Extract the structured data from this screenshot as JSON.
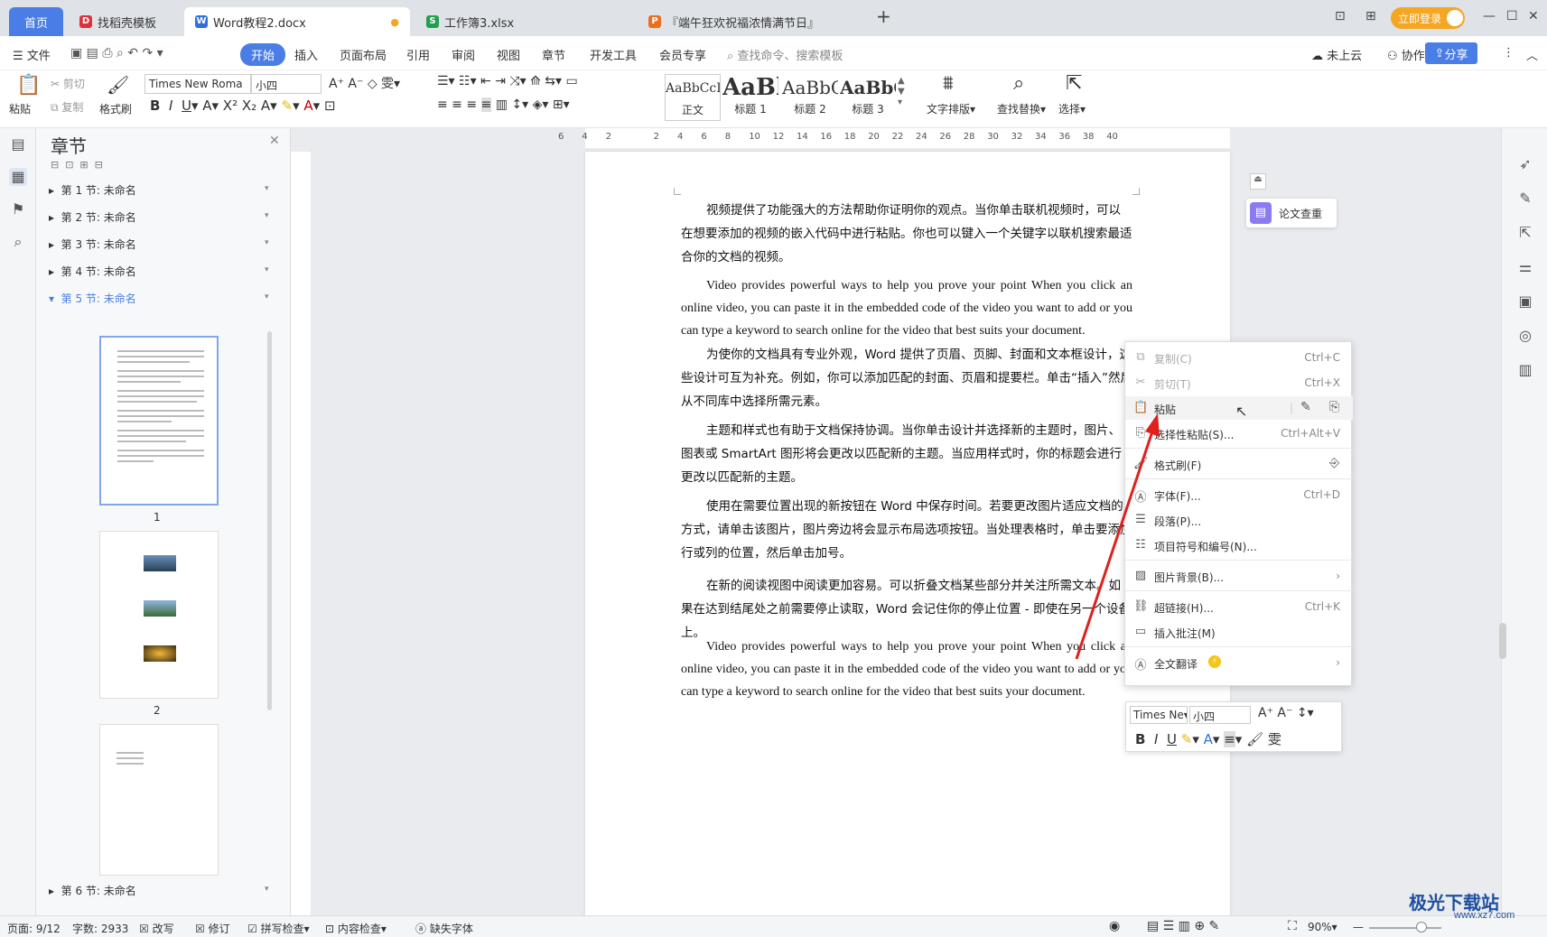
{
  "tabs": [
    {
      "label": "首页"
    },
    {
      "label": "找稻壳模板",
      "icon_color": "#e0303c"
    },
    {
      "label": "Word教程2.docx",
      "icon_color": "#2f6fe0"
    },
    {
      "label": "工作簿3.xlsx",
      "icon_color": "#22a050"
    },
    {
      "label": "『端午狂欢祝福浓情满节日』",
      "icon_color": "#ef6c1c"
    }
  ],
  "login_label": "立即登录",
  "menu": {
    "file": "文件",
    "items": [
      "开始",
      "插入",
      "页面布局",
      "引用",
      "审阅",
      "视图",
      "章节",
      "开发工具",
      "会员专享"
    ],
    "search_placeholder": "查找命令、搜索模板",
    "cloud": "未上云",
    "collab": "协作",
    "share": "分享"
  },
  "ribbon": {
    "paste": "粘贴",
    "cut": "剪切",
    "copy": "复制",
    "format_painter": "格式刷",
    "font": "Times New Roma",
    "size": "小四",
    "styles": [
      {
        "sample": "AaBbCcI",
        "label": "正文"
      },
      {
        "sample": "AaBl",
        "label": "标题 1"
      },
      {
        "sample": "AaBbC",
        "label": "标题 2"
      },
      {
        "sample": "AaBbC",
        "label": "标题 3"
      }
    ],
    "text_layout": "文字排版",
    "find_replace": "查找替换",
    "select": "选择"
  },
  "chapter_panel": {
    "title": "章节",
    "sections": [
      "第 1 节: 未命名",
      "第 2 节: 未命名",
      "第 3 节: 未命名",
      "第 4 节: 未命名",
      "第 5 节: 未命名",
      "第 6 节: 未命名"
    ],
    "active_index": 4,
    "page_numbers": [
      "1",
      "2"
    ]
  },
  "ruler_ticks": [
    "6",
    "4",
    "2",
    "",
    "2",
    "4",
    "6",
    "8",
    "10",
    "12",
    "14",
    "16",
    "18",
    "20",
    "22",
    "24",
    "26",
    "28",
    "30",
    "32",
    "34",
    "36",
    "38",
    "40"
  ],
  "document": {
    "paragraphs": [
      "视频提供了功能强大的方法帮助你证明你的观点。当你单击联机视频时，可以在想要添加的视频的嵌入代码中进行粘贴。你也可以键入一个关键字以联机搜索最适合你的文档的视频。",
      "Video provides powerful ways to help you prove your point When you click an online video, you can paste it in the embedded code of the video you want to add or you can type a keyword to search online for the video that best suits your document.",
      "为使你的文档具有专业外观，Word 提供了页眉、页脚、封面和文本框设计，这些设计可互为补充。例如，你可以添加匹配的封面、页眉和提要栏。单击“插入”然后从不同库中选择所需元素。",
      "主题和样式也有助于文档保持协调。当你单击设计并选择新的主题时，图片、图表或 SmartArt 图形将会更改以匹配新的主题。当应用样式时，你的标题会进行更改以匹配新的主题。",
      "使用在需要位置出现的新按钮在 Word 中保存时间。若要更改图片适应文档的方式，请单击该图片，图片旁边将会显示布局选项按钮。当处理表格时，单击要添加行或列的位置，然后单击加号。",
      "在新的阅读视图中阅读更加容易。可以折叠文档某些部分并关注所需文本。如果在达到结尾处之前需要停止读取，Word 会记住你的停止位置 - 即使在另一个设备上。",
      "Video provides powerful ways to help you prove your point When you click an online video, you can paste it in the embedded code of the video you want to add or you can type a keyword to search online for the video that best suits your document."
    ]
  },
  "paper_check": "论文查重",
  "context_menu": {
    "items": [
      {
        "label": "复制(C)",
        "shortcut": "Ctrl+C",
        "icon": "copy-icon",
        "disabled": true
      },
      {
        "label": "剪切(T)",
        "shortcut": "Ctrl+X",
        "icon": "scissors-icon",
        "disabled": true
      },
      {
        "label": "粘贴",
        "shortcut": "",
        "icon": "paste-icon",
        "disabled": false
      },
      {
        "label": "选择性粘贴(S)...",
        "shortcut": "Ctrl+Alt+V",
        "icon": "paste-special-icon",
        "disabled": false
      },
      {
        "label": "格式刷(F)",
        "shortcut": "",
        "icon": "format-painter-icon",
        "disabled": false
      },
      {
        "label": "字体(F)...",
        "shortcut": "Ctrl+D",
        "icon": "font-icon",
        "disabled": false
      },
      {
        "label": "段落(P)...",
        "shortcut": "",
        "icon": "paragraph-icon",
        "disabled": false
      },
      {
        "label": "项目符号和编号(N)...",
        "shortcut": "",
        "icon": "list-icon",
        "disabled": false
      },
      {
        "label": "图片背景(B)...",
        "shortcut": "›",
        "icon": "image-icon",
        "disabled": false
      },
      {
        "label": "超链接(H)...",
        "shortcut": "Ctrl+K",
        "icon": "link-icon",
        "disabled": false
      },
      {
        "label": "插入批注(M)",
        "shortcut": "",
        "icon": "comment-icon",
        "disabled": false
      },
      {
        "label": "全文翻译",
        "shortcut": "›",
        "icon": "translate-icon",
        "disabled": false
      }
    ]
  },
  "mini_toolbar": {
    "font": "Times Ne",
    "size": "小四"
  },
  "status": {
    "page": "页面: 9/12",
    "words": "字数: 2933",
    "revise": "改写",
    "track": "修订",
    "spell": "拼写检查",
    "content": "内容检查",
    "missing_font": "缺失字体",
    "zoom": "90%"
  },
  "watermark": "极光下载站",
  "watermark_url": "www.xz7.com",
  "accent_color": "#4a7ee6",
  "arrow_color": "#e0201c"
}
